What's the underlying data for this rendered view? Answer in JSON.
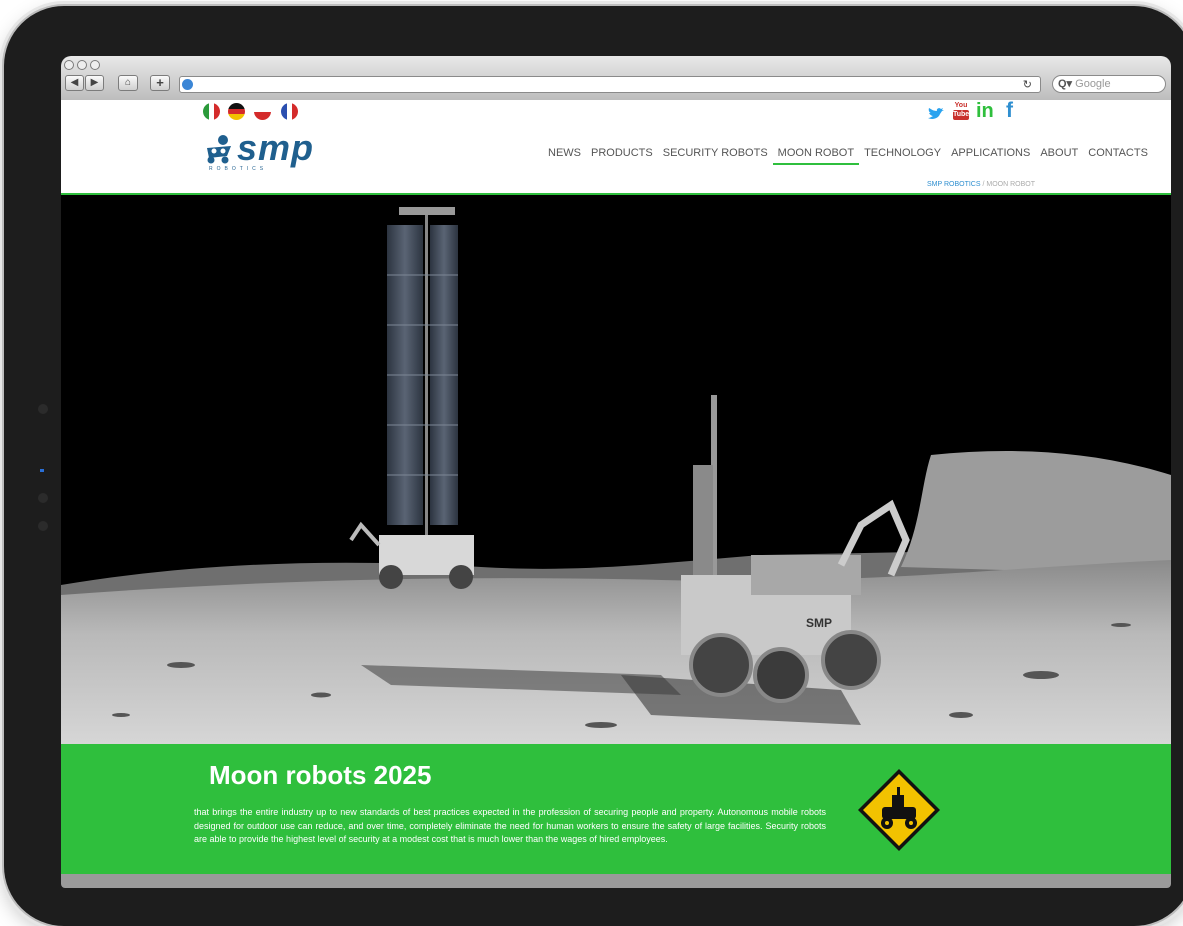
{
  "browser": {
    "search_placeholder": "Google",
    "reload_icon": "reload-icon"
  },
  "header": {
    "languages": [
      "Italian",
      "German",
      "Polish",
      "French"
    ],
    "logo_text": "smp",
    "logo_subtext": "ROBOTICS",
    "social": [
      "twitter",
      "youtube",
      "linkedin",
      "facebook"
    ],
    "menu": [
      {
        "label": "NEWS"
      },
      {
        "label": "PRODUCTS"
      },
      {
        "label": "SECURITY ROBOTS"
      },
      {
        "label": "MOON ROBOT",
        "active": true
      },
      {
        "label": "TECHNOLOGY"
      },
      {
        "label": "APPLICATIONS"
      },
      {
        "label": "ABOUT"
      },
      {
        "label": "CONTACTS"
      }
    ],
    "breadcrumb_home": "SMP ROBOTICS",
    "breadcrumb_sep": " / ",
    "breadcrumb_current": "MOON ROBOT"
  },
  "band": {
    "title": "Moon robots 2025",
    "text": "that brings the entire industry up to new standards of best practices expected in the profession of securing people and property. Autonomous mobile robots designed for outdoor use can reduce, and over time, completely eliminate the need for human workers to ensure the safety of large facilities. Security robots are able to provide the highest level of security at a modest cost that is much lower than the wages of hired employees."
  },
  "colors": {
    "accent": "#2fbf3d",
    "logo": "#1f5f8e",
    "sign": "#f2c200"
  }
}
